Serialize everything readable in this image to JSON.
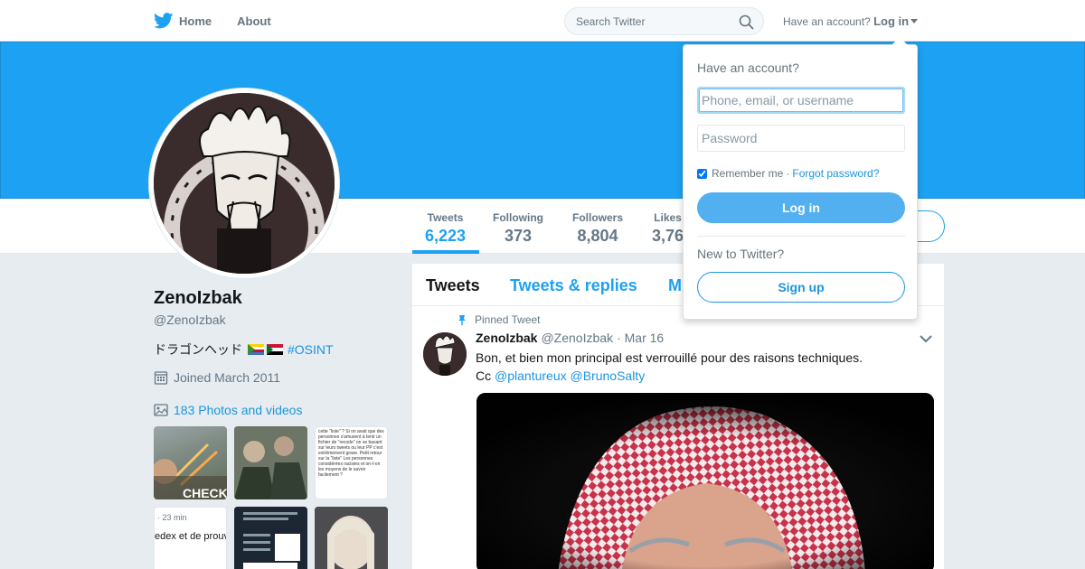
{
  "nav": {
    "home_label": "Home",
    "about_label": "About",
    "search_placeholder": "Search Twitter",
    "account_prompt": "Have an account?",
    "login_label": "Log in"
  },
  "profile": {
    "name": "ZenoIzbak",
    "handle": "@ZenoIzbak",
    "bio_text": "ドラゴンヘッド",
    "bio_hashtag": "#OSINT",
    "joined": "Joined March 2011",
    "photos_link": "183 Photos and videos"
  },
  "stats": [
    {
      "label": "Tweets",
      "value": "6,223"
    },
    {
      "label": "Following",
      "value": "373"
    },
    {
      "label": "Followers",
      "value": "8,804"
    },
    {
      "label": "Likes",
      "value": "3,76"
    }
  ],
  "timeline": {
    "tabs": [
      "Tweets",
      "Tweets & replies",
      "M"
    ]
  },
  "tweet": {
    "pinned_label": "Pinned Tweet",
    "author_name": "ZenoIzbak",
    "author_handle": "@ZenoIzbak",
    "date": "· Mar 16",
    "text_line1": "Bon, et bien mon principal est verrouillé pour des raisons techniques.",
    "text_cc": "Cc",
    "mention1": "@plantureux",
    "mention2": "@BrunoSalty"
  },
  "thumbnails": {
    "t1_caption": "CHECK",
    "t3_text": "cette \"liste\" ? Si on avait que des personnes s'amusent à tenir un fichier de \"recode\" on se basant sur leurs tweets ou leur PP c'est extrêmement grave. Petit retour sur la \"liste\" Les personnes considérées racistes et on-t-on les moyens de le savoir facilement ?",
    "t4_text1": "· 23 min",
    "t4_text2": "edex et de prouver"
  },
  "login_dropdown": {
    "title": "Have an account?",
    "username_placeholder": "Phone, email, or username",
    "password_placeholder": "Password",
    "remember_label": "Remember me",
    "separator": "·",
    "forgot_label": "Forgot password?",
    "login_button": "Log in",
    "new_prompt": "New to Twitter?",
    "signup_button": "Sign up"
  },
  "colors": {
    "brand": "#1da1f2",
    "link": "#1b95e0",
    "background": "#e6ecf0"
  }
}
